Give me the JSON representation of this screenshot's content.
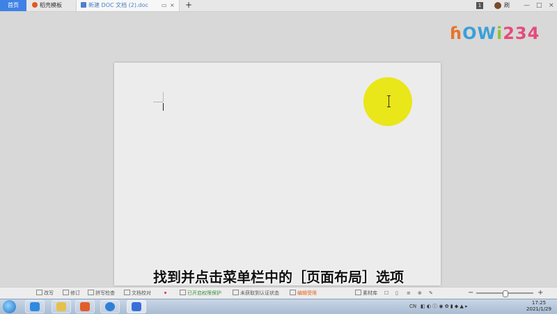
{
  "titlebar": {
    "tabs": [
      {
        "label": "首页"
      },
      {
        "label": "稻壳模板"
      },
      {
        "label": "新建 DOC 文档 (2).doc"
      }
    ],
    "new_tab": "+",
    "badge": "1",
    "user": "刷",
    "window_buttons": [
      "—",
      "□",
      "×"
    ]
  },
  "logo": {
    "parts": [
      "ɦ",
      "OW",
      "i",
      "234"
    ]
  },
  "caption": "找到并点击菜单栏中的［页面布局］选项",
  "statusbar": {
    "items": [
      {
        "label": "改写"
      },
      {
        "label": "修订"
      },
      {
        "label": "拼写检查"
      },
      {
        "label": "文档校对"
      },
      {
        "label": "已开启权限保护"
      },
      {
        "label": "未获取到认证状态"
      },
      {
        "label": "编辑受限"
      },
      {
        "label": "素材库"
      }
    ],
    "zoom_minus": "−",
    "zoom_plus": "+"
  },
  "taskbar": {
    "tray_text": "CN",
    "time": "17:25",
    "date": "2021/1/29"
  },
  "colors": {
    "home_tab": "#3f82e6",
    "highlight": "#e9e619",
    "accent_orange": "#e0641c"
  }
}
